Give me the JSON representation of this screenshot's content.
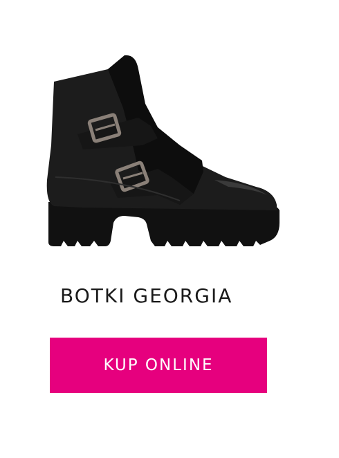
{
  "product": {
    "name": "BOTKI GEORGIA",
    "image_alt": "boot-image"
  },
  "cta": {
    "label": "KUP ONLINE",
    "color": "#e6007e"
  }
}
